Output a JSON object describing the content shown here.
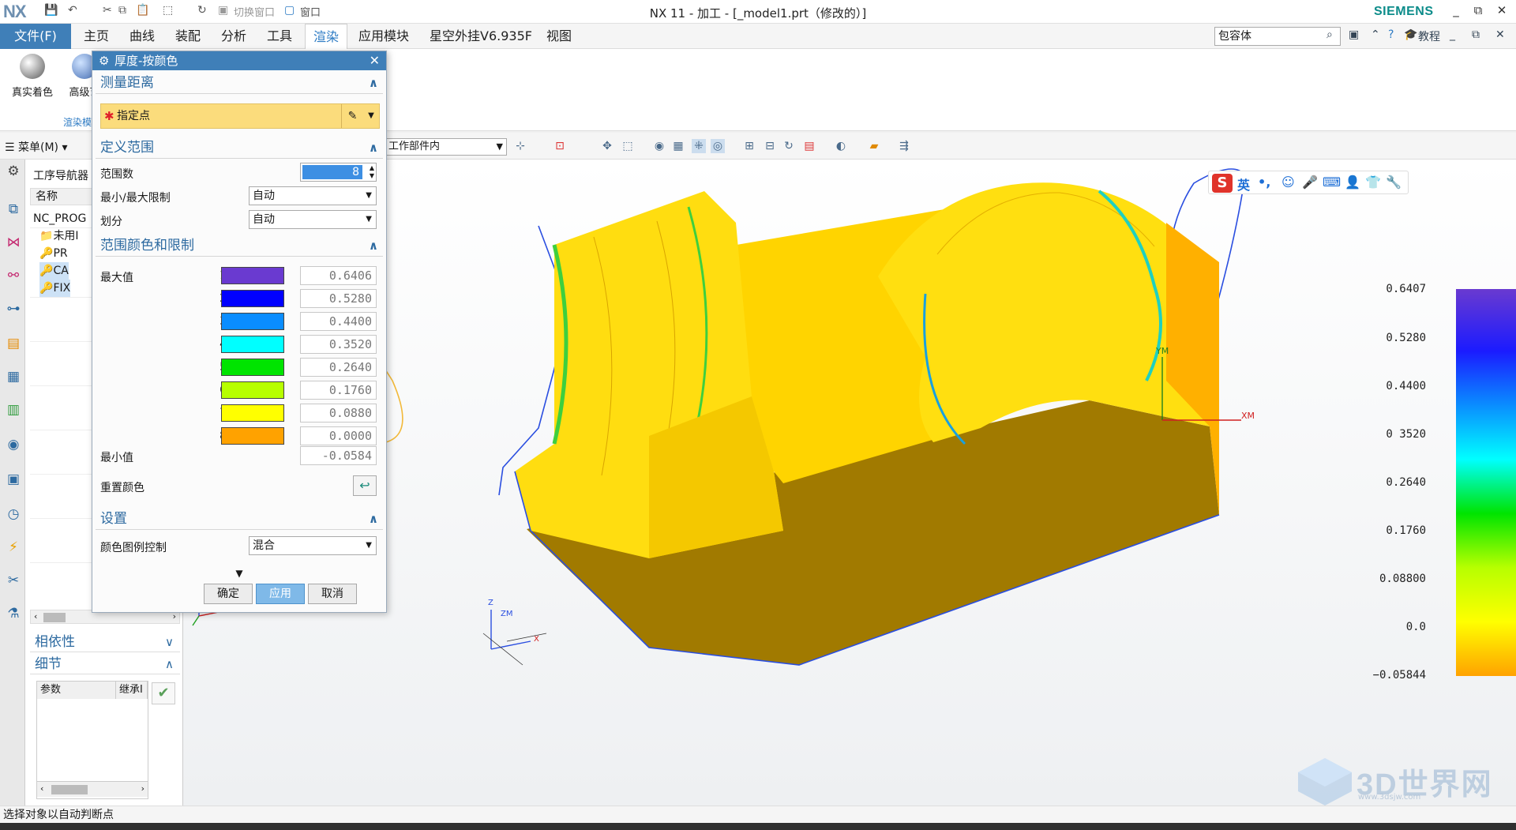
{
  "app": {
    "logo": "NX",
    "window_title": "NX 11 - 加工 - [_model1.prt（修改的）]",
    "brand": "SIEMENS",
    "quick_access": {
      "switch_window": "切换窗口",
      "window": "窗口"
    },
    "window_controls": [
      "_",
      "⧉",
      "✕"
    ]
  },
  "menubar": {
    "file": "文件(F)",
    "tabs": [
      "主页",
      "曲线",
      "装配",
      "分析",
      "工具",
      "渲染",
      "应用模块",
      "星空外挂V6.935F",
      "视图"
    ],
    "active_tab": "渲染",
    "search_value": "包容体",
    "tutorial": "教程"
  },
  "ribbon": {
    "buttons": [
      "真实着色",
      "高级艺"
    ],
    "group_label": "渲染模"
  },
  "commandbar": {
    "menu": "菜单(M)",
    "filter_value": "工作部件内"
  },
  "navigator": {
    "title": "工序导航器",
    "header": "名称",
    "rows": [
      "NC_PROG",
      "未用I",
      "PR",
      "CA",
      "FIX"
    ],
    "dependency": "相依性",
    "details": "细节",
    "detail_cols": [
      "参数",
      "继承I"
    ]
  },
  "dialog": {
    "title": "厚度-按颜色",
    "sections": {
      "measure": "测量距离",
      "range": "定义范围",
      "colors": "范围颜色和限制",
      "settings": "设置"
    },
    "specify_point": "指定点",
    "range_count_label": "范围数",
    "range_count": "8",
    "minmax_label": "最小/最大限制",
    "minmax_value": "自动",
    "division_label": "划分",
    "division_value": "自动",
    "max_label": "最大值",
    "min_label": "最小值",
    "min_value": "-0.0584",
    "reset_colors": "重置颜色",
    "legend_control_label": "颜色图例控制",
    "legend_control_value": "混合",
    "buttons": {
      "ok": "确定",
      "apply": "应用",
      "cancel": "取消"
    },
    "color_rows": [
      {
        "index": "1",
        "color": "#6a3ad0",
        "value": "0.6406"
      },
      {
        "index": "2",
        "color": "#0000ff",
        "value": "0.5280"
      },
      {
        "index": "3",
        "color": "#0a8dff",
        "value": "0.4400"
      },
      {
        "index": "4",
        "color": "#00ffff",
        "value": "0.3520"
      },
      {
        "index": "5",
        "color": "#00e400",
        "value": "0.2640"
      },
      {
        "index": "6",
        "color": "#b7ff00",
        "value": "0.1760"
      },
      {
        "index": "7",
        "color": "#ffff00",
        "value": "0.0880"
      },
      {
        "index": "8",
        "color": "#ffa200",
        "value": "0.0000"
      }
    ]
  },
  "legend": {
    "labels": [
      "0.6407",
      "0.5280",
      "0.4400",
      "0 3520",
      "0.2640",
      "0.1760",
      "0.08800",
      "0.0",
      "−0.05844"
    ]
  },
  "viewport": {
    "triad_labels": {
      "z": "Z",
      "x": "X",
      "ym": "YM",
      "xm": "XM",
      "zm": "ZM"
    },
    "ime": {
      "lang": "英"
    }
  },
  "watermark": {
    "text": "3D世界网",
    "sub": "www.3dsjw.com"
  },
  "status": {
    "text": "选择对象以自动判断点"
  }
}
